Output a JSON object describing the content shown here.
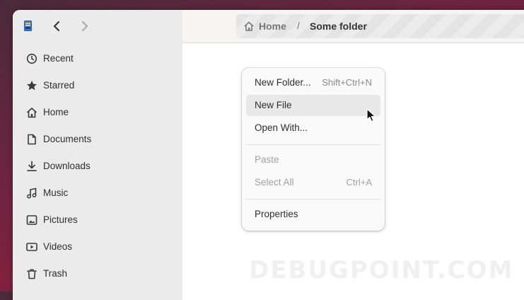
{
  "colors": {
    "accent": "#3584e4",
    "wallpaper": "#8a1f3e",
    "sidebar_bg": "#ebebeb"
  },
  "header": {
    "back_icon": "chevron-left-icon",
    "forward_icon": "chevron-right-icon",
    "breadcrumb": {
      "home": "Home",
      "separator": "/",
      "current": "Some folder"
    }
  },
  "sidebar": {
    "items": [
      {
        "label": "Recent",
        "icon": "clock-icon"
      },
      {
        "label": "Starred",
        "icon": "star-icon"
      },
      {
        "label": "Home",
        "icon": "home-icon"
      },
      {
        "label": "Documents",
        "icon": "document-icon"
      },
      {
        "label": "Downloads",
        "icon": "download-icon"
      },
      {
        "label": "Music",
        "icon": "music-icon"
      },
      {
        "label": "Pictures",
        "icon": "picture-icon"
      },
      {
        "label": "Videos",
        "icon": "video-icon"
      },
      {
        "label": "Trash",
        "icon": "trash-icon"
      }
    ]
  },
  "context_menu": {
    "new_folder": {
      "label": "New Folder...",
      "shortcut": "Shift+Ctrl+N"
    },
    "new_file": {
      "label": "New File"
    },
    "open_with": {
      "label": "Open With..."
    },
    "paste": {
      "label": "Paste"
    },
    "select_all": {
      "label": "Select All",
      "shortcut": "Ctrl+A"
    },
    "properties": {
      "label": "Properties"
    }
  },
  "watermark": "DEBUGPOINT.COM"
}
